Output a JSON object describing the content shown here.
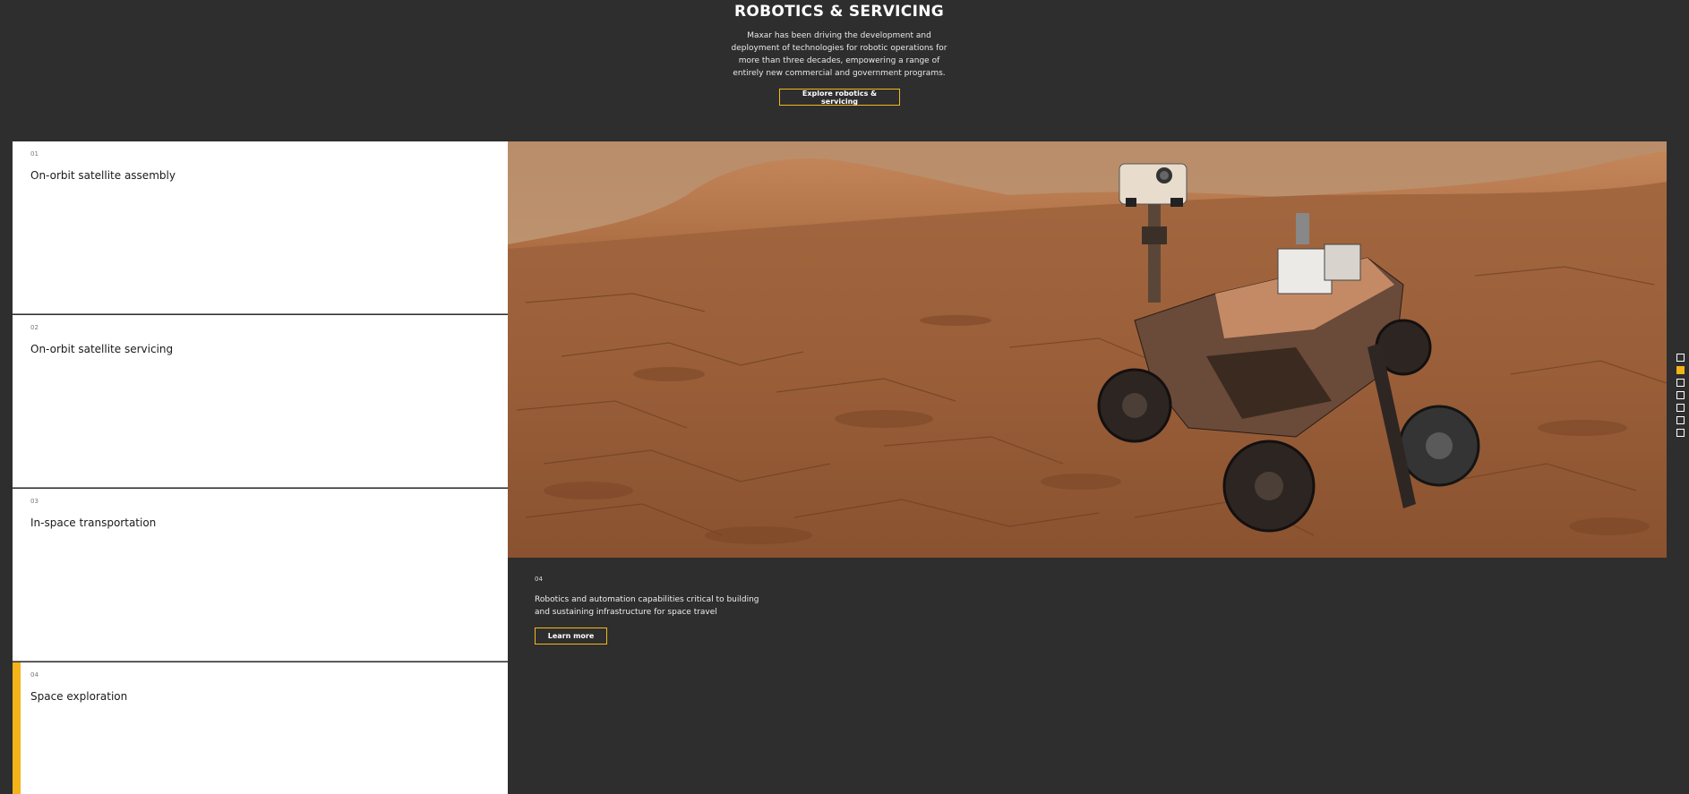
{
  "hero": {
    "title": "ROBOTICS & SERVICING",
    "description": "Maxar has been driving the development and deployment of technologies for robotic operations for more than three decades, empowering a range of entirely new commercial and government programs.",
    "button_label": "Explore robotics & servicing"
  },
  "cards": [
    {
      "num": "01",
      "title": "On-orbit satellite assembly"
    },
    {
      "num": "02",
      "title": "On-orbit satellite servicing"
    },
    {
      "num": "03",
      "title": "In-space transportation"
    },
    {
      "num": "04",
      "title": "Space exploration"
    }
  ],
  "panel": {
    "num": "04",
    "description": "Robotics and automation capabilities critical to building and sustaining infrastructure for space travel",
    "button_label": "Learn more",
    "image_icon": "mars-rover-photo"
  },
  "nav_dots": {
    "count": 7,
    "active_index": 1
  },
  "colors": {
    "accent": "#f4b31b",
    "background": "#2e2e2e"
  }
}
